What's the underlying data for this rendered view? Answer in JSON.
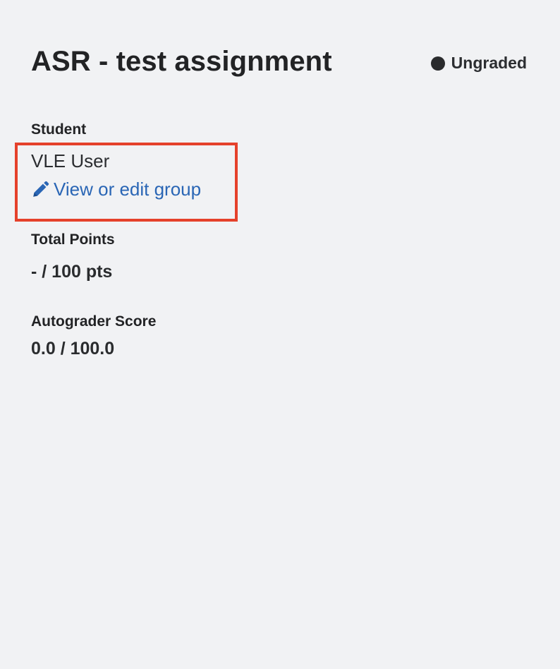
{
  "assignment": {
    "title": "ASR - test assignment",
    "status": "Ungraded"
  },
  "student": {
    "label": "Student",
    "name": "VLE User",
    "edit_link": "View or edit group"
  },
  "points": {
    "label": "Total Points",
    "value": "- / 100 pts"
  },
  "autograder": {
    "label": "Autograder Score",
    "value": "0.0 / 100.0"
  },
  "colors": {
    "background": "#f1f2f4",
    "link": "#2a66b5",
    "highlight": "#e5412b",
    "text": "#222325"
  },
  "icons": {
    "status": "circle-dot-icon",
    "edit": "pencil-icon"
  }
}
